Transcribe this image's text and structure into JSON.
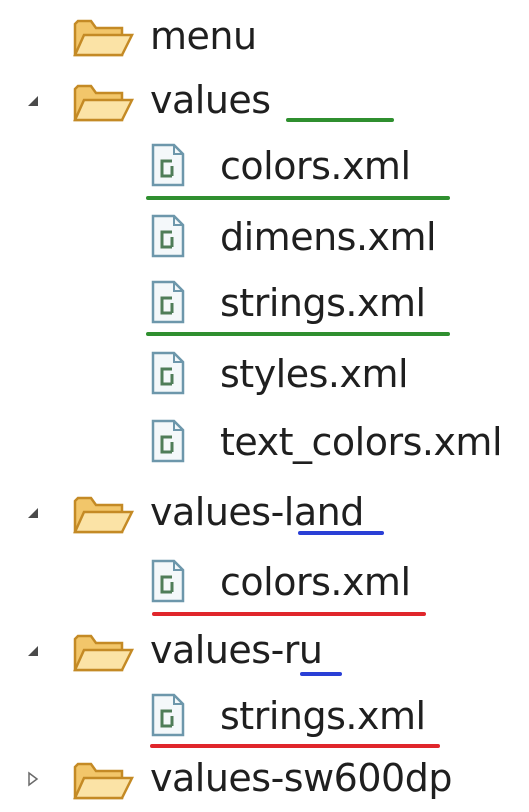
{
  "tree": {
    "menu": {
      "label": "menu"
    },
    "values": {
      "label": "values",
      "expanded": true
    },
    "values_colors": {
      "label": "colors.xml"
    },
    "values_dimens": {
      "label": "dimens.xml"
    },
    "values_strings": {
      "label": "strings.xml"
    },
    "values_styles": {
      "label": "styles.xml"
    },
    "values_text_colors": {
      "label": "text_colors.xml"
    },
    "values_land": {
      "label": "values-land",
      "expanded": true
    },
    "land_colors": {
      "label": "colors.xml"
    },
    "values_ru": {
      "label": "values-ru",
      "expanded": true
    },
    "ru_strings": {
      "label": "strings.xml"
    },
    "values_sw600dp": {
      "label": "values-sw600dp",
      "expanded": false
    }
  },
  "colors": {
    "green_marker": "#2f8f2f",
    "blue_marker": "#2a3fd6",
    "red_marker": "#e0262b",
    "folder_fill": "#f7d58a",
    "folder_stroke": "#c9932e",
    "file_stroke": "#5c8fa8"
  },
  "icons": {
    "folder": "folder-icon",
    "xml_file": "xml-file-icon",
    "expanded": "expanded-triangle-icon",
    "collapsed": "collapsed-triangle-icon"
  }
}
